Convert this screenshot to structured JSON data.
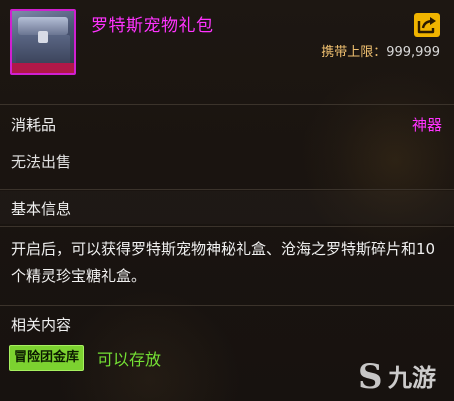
{
  "item": {
    "name": "罗特斯宠物礼包",
    "carry_limit_label": "携带上限：",
    "carry_limit_value": "999,999",
    "thumbnail_icon": "gift-chest-icon",
    "share_icon": "share-icon"
  },
  "category": {
    "type": "消耗品",
    "rarity": "神器",
    "sell_status": "无法出售"
  },
  "basic_info": {
    "heading": "基本信息",
    "description": "开启后，可以获得罗特斯宠物神秘礼盒、沧海之罗特斯碎片和10个精灵珍宝糖礼盒。"
  },
  "related": {
    "heading": "相关内容",
    "tag": "冒险团金库",
    "tag_note": "可以存放"
  },
  "watermark": {
    "text": "九游"
  },
  "colors": {
    "rarity": "#ff33ff",
    "limit_label": "#f0c070",
    "tag_bg": "#7cd230",
    "storable": "#74e034",
    "share_bg": "#f0b400"
  }
}
